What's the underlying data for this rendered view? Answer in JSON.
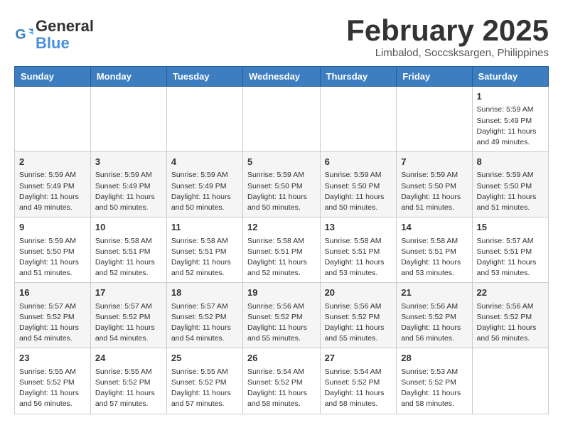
{
  "header": {
    "logo_line1": "General",
    "logo_line2": "Blue",
    "title": "February 2025",
    "subtitle": "Limbalod, Soccsksargen, Philippines"
  },
  "weekdays": [
    "Sunday",
    "Monday",
    "Tuesday",
    "Wednesday",
    "Thursday",
    "Friday",
    "Saturday"
  ],
  "weeks": [
    [
      {
        "day": "",
        "info": ""
      },
      {
        "day": "",
        "info": ""
      },
      {
        "day": "",
        "info": ""
      },
      {
        "day": "",
        "info": ""
      },
      {
        "day": "",
        "info": ""
      },
      {
        "day": "",
        "info": ""
      },
      {
        "day": "1",
        "info": "Sunrise: 5:59 AM\nSunset: 5:49 PM\nDaylight: 11 hours\nand 49 minutes."
      }
    ],
    [
      {
        "day": "2",
        "info": "Sunrise: 5:59 AM\nSunset: 5:49 PM\nDaylight: 11 hours\nand 49 minutes."
      },
      {
        "day": "3",
        "info": "Sunrise: 5:59 AM\nSunset: 5:49 PM\nDaylight: 11 hours\nand 50 minutes."
      },
      {
        "day": "4",
        "info": "Sunrise: 5:59 AM\nSunset: 5:49 PM\nDaylight: 11 hours\nand 50 minutes."
      },
      {
        "day": "5",
        "info": "Sunrise: 5:59 AM\nSunset: 5:50 PM\nDaylight: 11 hours\nand 50 minutes."
      },
      {
        "day": "6",
        "info": "Sunrise: 5:59 AM\nSunset: 5:50 PM\nDaylight: 11 hours\nand 50 minutes."
      },
      {
        "day": "7",
        "info": "Sunrise: 5:59 AM\nSunset: 5:50 PM\nDaylight: 11 hours\nand 51 minutes."
      },
      {
        "day": "8",
        "info": "Sunrise: 5:59 AM\nSunset: 5:50 PM\nDaylight: 11 hours\nand 51 minutes."
      }
    ],
    [
      {
        "day": "9",
        "info": "Sunrise: 5:59 AM\nSunset: 5:50 PM\nDaylight: 11 hours\nand 51 minutes."
      },
      {
        "day": "10",
        "info": "Sunrise: 5:58 AM\nSunset: 5:51 PM\nDaylight: 11 hours\nand 52 minutes."
      },
      {
        "day": "11",
        "info": "Sunrise: 5:58 AM\nSunset: 5:51 PM\nDaylight: 11 hours\nand 52 minutes."
      },
      {
        "day": "12",
        "info": "Sunrise: 5:58 AM\nSunset: 5:51 PM\nDaylight: 11 hours\nand 52 minutes."
      },
      {
        "day": "13",
        "info": "Sunrise: 5:58 AM\nSunset: 5:51 PM\nDaylight: 11 hours\nand 53 minutes."
      },
      {
        "day": "14",
        "info": "Sunrise: 5:58 AM\nSunset: 5:51 PM\nDaylight: 11 hours\nand 53 minutes."
      },
      {
        "day": "15",
        "info": "Sunrise: 5:57 AM\nSunset: 5:51 PM\nDaylight: 11 hours\nand 53 minutes."
      }
    ],
    [
      {
        "day": "16",
        "info": "Sunrise: 5:57 AM\nSunset: 5:52 PM\nDaylight: 11 hours\nand 54 minutes."
      },
      {
        "day": "17",
        "info": "Sunrise: 5:57 AM\nSunset: 5:52 PM\nDaylight: 11 hours\nand 54 minutes."
      },
      {
        "day": "18",
        "info": "Sunrise: 5:57 AM\nSunset: 5:52 PM\nDaylight: 11 hours\nand 54 minutes."
      },
      {
        "day": "19",
        "info": "Sunrise: 5:56 AM\nSunset: 5:52 PM\nDaylight: 11 hours\nand 55 minutes."
      },
      {
        "day": "20",
        "info": "Sunrise: 5:56 AM\nSunset: 5:52 PM\nDaylight: 11 hours\nand 55 minutes."
      },
      {
        "day": "21",
        "info": "Sunrise: 5:56 AM\nSunset: 5:52 PM\nDaylight: 11 hours\nand 56 minutes."
      },
      {
        "day": "22",
        "info": "Sunrise: 5:56 AM\nSunset: 5:52 PM\nDaylight: 11 hours\nand 56 minutes."
      }
    ],
    [
      {
        "day": "23",
        "info": "Sunrise: 5:55 AM\nSunset: 5:52 PM\nDaylight: 11 hours\nand 56 minutes."
      },
      {
        "day": "24",
        "info": "Sunrise: 5:55 AM\nSunset: 5:52 PM\nDaylight: 11 hours\nand 57 minutes."
      },
      {
        "day": "25",
        "info": "Sunrise: 5:55 AM\nSunset: 5:52 PM\nDaylight: 11 hours\nand 57 minutes."
      },
      {
        "day": "26",
        "info": "Sunrise: 5:54 AM\nSunset: 5:52 PM\nDaylight: 11 hours\nand 58 minutes."
      },
      {
        "day": "27",
        "info": "Sunrise: 5:54 AM\nSunset: 5:52 PM\nDaylight: 11 hours\nand 58 minutes."
      },
      {
        "day": "28",
        "info": "Sunrise: 5:53 AM\nSunset: 5:52 PM\nDaylight: 11 hours\nand 58 minutes."
      },
      {
        "day": "",
        "info": ""
      }
    ]
  ]
}
